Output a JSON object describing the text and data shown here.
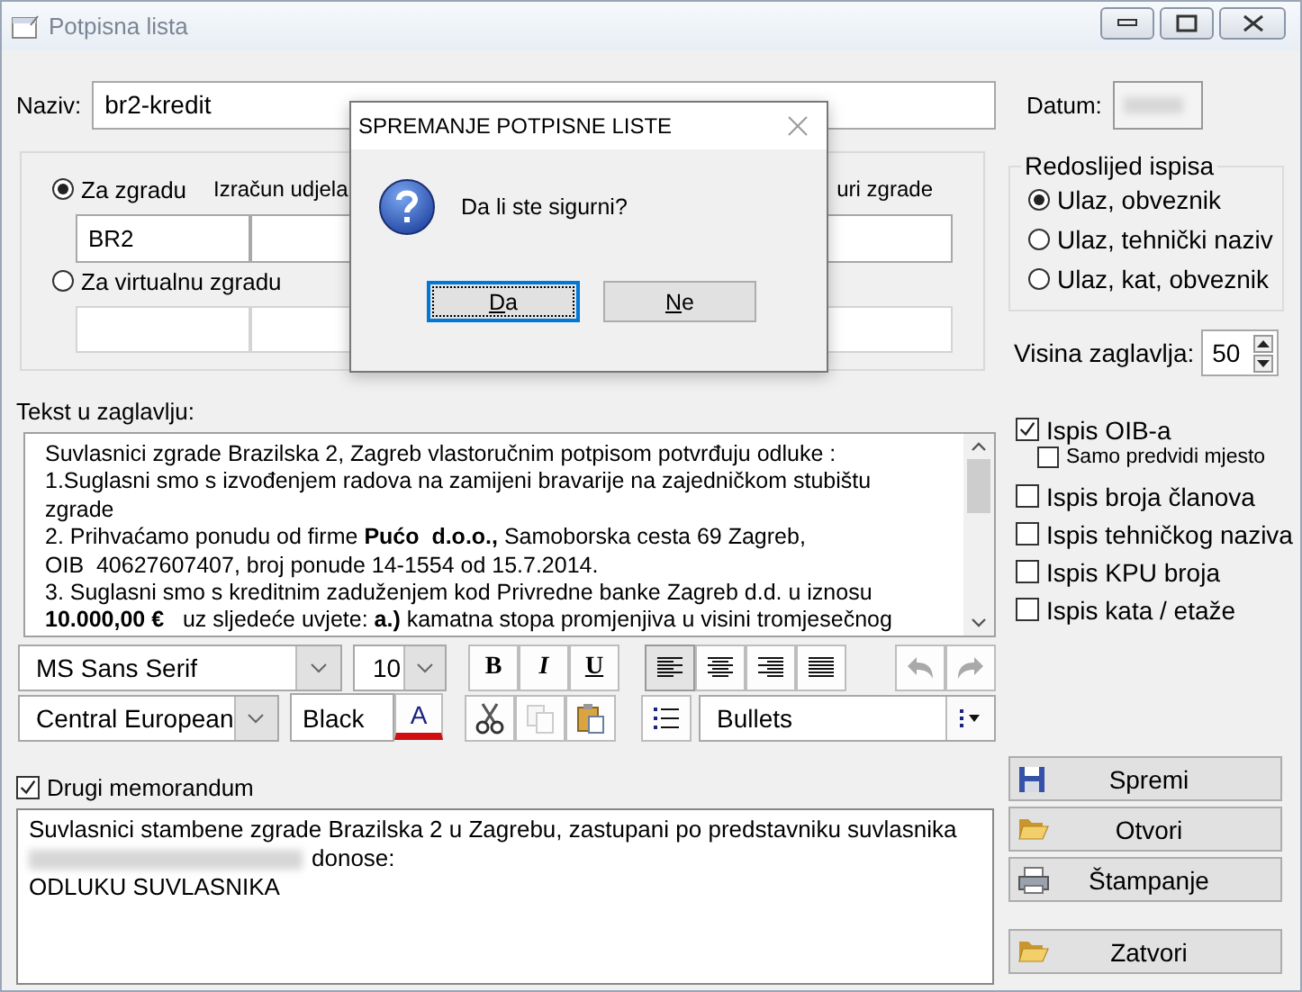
{
  "window": {
    "title": "Potpisna lista"
  },
  "naziv": {
    "label": "Naziv:",
    "value": "br2-kredit"
  },
  "datum": {
    "label": "Datum:",
    "redacted": true
  },
  "building": {
    "options": [
      {
        "label": "Za zgradu",
        "selected": true,
        "code": "BR2"
      },
      {
        "label": "Za virtualnu zgradu",
        "selected": false
      }
    ],
    "column_labels": [
      "Izračun udjela",
      "uri zgrade"
    ]
  },
  "header_text": {
    "label": "Tekst u zaglavlju:",
    "lines": [
      "Suvlasnici zgrade Brazilska 2, Zagreb vlastoručnim potpisom potvrđuju odluke :",
      "1.Suglasni smo s izvođenjem radova na zamijeni bravarije na zajedničkom stubištu",
      "zgrade",
      "2. Prihvaćamo ponudu od firme **Pućo  d.o.o.,** Samoborska cesta 69 Zagreb,",
      "OIB  40627607407, broj ponude 14-1554 od 15.7.2014.",
      "3. Suglasni smo s kreditnim zaduženjem kod Privredne banke Zagreb d.d. u iznosu",
      "**10.000,00 €**   uz sljedeće uvjete: **a.)** kamatna stopa promjenjiva u visini tromjesečnog"
    ]
  },
  "toolbar": {
    "font": "MS Sans Serif",
    "size": "10",
    "format_buttons": [
      {
        "label": "B",
        "kind": "bold"
      },
      {
        "label": "I",
        "kind": "italic"
      },
      {
        "label": "U",
        "kind": "underline"
      }
    ],
    "align_buttons": [
      {
        "kind": "left",
        "selected": true
      },
      {
        "kind": "center",
        "selected": false
      },
      {
        "kind": "right",
        "selected": false
      },
      {
        "kind": "justify",
        "selected": false
      }
    ],
    "history_buttons": [
      {
        "kind": "undo",
        "disabled": true
      },
      {
        "kind": "redo",
        "disabled": true
      }
    ],
    "charset": "Central European",
    "color_name": "Black",
    "color_button": "A",
    "edit_buttons": [
      {
        "kind": "cut",
        "disabled": false
      },
      {
        "kind": "copy",
        "disabled": true
      },
      {
        "kind": "paste",
        "disabled": false
      }
    ],
    "list_style": "Bullets"
  },
  "memo": {
    "label": "Drugi memorandum",
    "checked": true,
    "lines": [
      {
        "text": "Suvlasnici stambene zgrade Brazilska 2 u Zagrebu, zastupani po predstavniku suvlasnika",
        "redacted": false
      },
      {
        "text": "donose:",
        "redacted": true
      },
      {
        "text": "ODLUKU SUVLASNIKA",
        "redacted": false
      }
    ]
  },
  "order": {
    "title": "Redoslijed ispisa",
    "options": [
      {
        "label": "Ulaz, obveznik",
        "selected": true
      },
      {
        "label": "Ulaz, tehnički naziv",
        "selected": false
      },
      {
        "label": "Ulaz, kat, obveznik",
        "selected": false
      }
    ]
  },
  "header_height": {
    "label": "Visina zaglavlja:",
    "value": "50"
  },
  "print_options": [
    {
      "label": "Ispis OIB-a",
      "checked": true,
      "children": [
        {
          "label": "Samo predvidi mjesto",
          "checked": false
        }
      ]
    },
    {
      "label": "Ispis broja članova",
      "checked": false
    },
    {
      "label": "Ispis tehničkog naziva",
      "checked": false
    },
    {
      "label": "Ispis KPU broja",
      "checked": false
    },
    {
      "label": "Ispis kata / etaže",
      "checked": false
    }
  ],
  "actions": [
    {
      "label": "Spremi",
      "kind": "save"
    },
    {
      "label": "Otvori",
      "kind": "open"
    },
    {
      "label": "Štampanje",
      "kind": "print"
    },
    {
      "label": "Zatvori",
      "kind": "close"
    }
  ],
  "dialog": {
    "title": "SPREMANJE POTPISNE LISTE",
    "message": "Da li ste sigurni?",
    "buttons": [
      {
        "label": "Da",
        "focused": true
      },
      {
        "label": "Ne",
        "focused": false
      }
    ]
  }
}
